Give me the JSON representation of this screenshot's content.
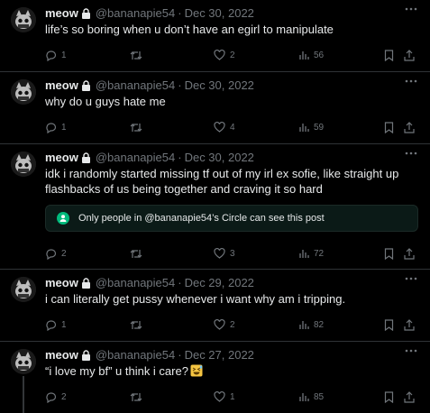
{
  "colors": {
    "background": "#000000",
    "text": "#e7e9ea",
    "muted": "#71767b",
    "divider": "#2f3336",
    "circle_bg": "#0b1a17",
    "circle_accent": "#00ba7c"
  },
  "tweets": [
    {
      "name": "meow",
      "handle": "@bananapie54",
      "sep": "·",
      "date": "Dec 30, 2022",
      "text": "life’s so boring when u don’t have an egirl to manipulate",
      "replies": "1",
      "retweets": "",
      "likes": "2",
      "views": "56"
    },
    {
      "name": "meow",
      "handle": "@bananapie54",
      "sep": "·",
      "date": "Dec 30, 2022",
      "text": "why do u guys hate me",
      "replies": "1",
      "retweets": "",
      "likes": "4",
      "views": "59"
    },
    {
      "name": "meow",
      "handle": "@bananapie54",
      "sep": "·",
      "date": "Dec 30, 2022",
      "text": "idk i randomly started missing tf out of my irl ex sofie, like straight up flashbacks of us being together and craving it so hard",
      "circle_notice": "Only people in @bananapie54’s Circle can see this post",
      "replies": "2",
      "retweets": "",
      "likes": "3",
      "views": "72"
    },
    {
      "name": "meow",
      "handle": "@bananapie54",
      "sep": "·",
      "date": "Dec 29, 2022",
      "text": "i can literally get pussy whenever i want why am i tripping.",
      "replies": "1",
      "retweets": "",
      "likes": "2",
      "views": "82"
    },
    {
      "name": "meow",
      "handle": "@bananapie54",
      "sep": "·",
      "date": "Dec 27, 2022",
      "text": "“i love my bf” u think i care?",
      "emoji": "laughing-sweat-emoji",
      "replies": "2",
      "retweets": "",
      "likes": "1",
      "views": "85"
    }
  ]
}
